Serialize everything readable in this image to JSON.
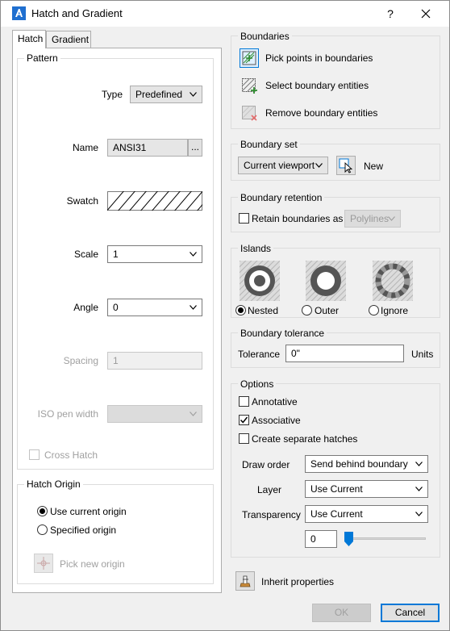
{
  "window": {
    "title": "Hatch and Gradient",
    "help_label": "?"
  },
  "tabs": [
    {
      "label": "Hatch",
      "active": true
    },
    {
      "label": "Gradient",
      "active": false
    }
  ],
  "pattern": {
    "title": "Pattern",
    "type_label": "Type",
    "type_value": "Predefined",
    "name_label": "Name",
    "name_value": "ANSI31",
    "browse_label": "...",
    "swatch_label": "Swatch",
    "scale_label": "Scale",
    "scale_value": "1",
    "angle_label": "Angle",
    "angle_value": "0",
    "spacing_label": "Spacing",
    "spacing_value": "1",
    "iso_label": "ISO pen width",
    "iso_value": "",
    "cross_hatch_label": "Cross Hatch"
  },
  "hatch_origin": {
    "title": "Hatch Origin",
    "use_current_label": "Use current origin",
    "specified_label": "Specified origin",
    "pick_new_label": "Pick new origin"
  },
  "boundaries": {
    "title": "Boundaries",
    "pick_points_label": "Pick points in boundaries",
    "select_entities_label": "Select boundary entities",
    "remove_entities_label": "Remove boundary entities"
  },
  "boundary_set": {
    "title": "Boundary set",
    "value": "Current viewport",
    "new_label": "New"
  },
  "boundary_retention": {
    "title": "Boundary retention",
    "retain_label": "Retain boundaries as",
    "retain_value": "Polylines"
  },
  "islands": {
    "title": "Islands",
    "nested_label": "Nested",
    "outer_label": "Outer",
    "ignore_label": "Ignore"
  },
  "boundary_tolerance": {
    "title": "Boundary tolerance",
    "tolerance_label": "Tolerance",
    "tolerance_value": "0\"",
    "units_label": "Units"
  },
  "options": {
    "title": "Options",
    "annotative_label": "Annotative",
    "associative_label": "Associative",
    "separate_label": "Create separate hatches",
    "draw_order_label": "Draw order",
    "draw_order_value": "Send behind boundary",
    "layer_label": "Layer",
    "layer_value": "Use Current",
    "transparency_label": "Transparency",
    "transparency_value": "Use Current",
    "transparency_amount": "0"
  },
  "inherit_label": "Inherit properties",
  "buttons": {
    "ok_label": "OK",
    "cancel_label": "Cancel"
  },
  "colors": {
    "accent": "#0078d7",
    "title_icon": "#1f6fd0"
  }
}
